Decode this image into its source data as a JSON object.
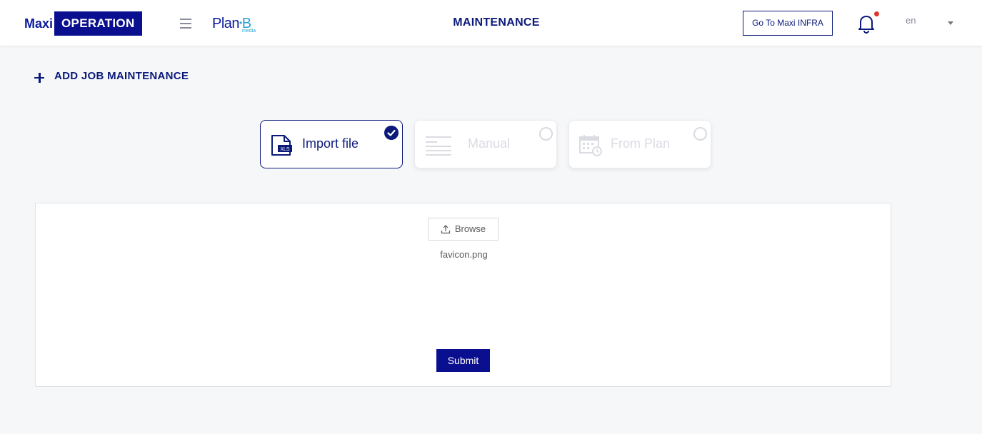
{
  "header": {
    "logo_maxi": "Maxi",
    "logo_operation": "OPERATION",
    "planb_main": "Plan",
    "planb_b": "B",
    "planb_sub": "media",
    "title": "MAINTENANCE",
    "infra_button": "Go To Maxi INFRA",
    "language": "en",
    "notification_dot_color": "#e0352b"
  },
  "add_job": {
    "label": "ADD JOB MAINTENANCE"
  },
  "options": [
    {
      "label": "Import file",
      "icon": "xls-file-icon",
      "selected": true
    },
    {
      "label": "Manual",
      "icon": "lines-icon",
      "selected": false
    },
    {
      "label": "From Plan",
      "icon": "calendar-clock-icon",
      "selected": false
    }
  ],
  "upload": {
    "browse_label": "Browse",
    "file_name": "favicon.png",
    "submit_label": "Submit"
  },
  "colors": {
    "brand": "#0a0f8f",
    "accent": "#2aa3d8"
  }
}
